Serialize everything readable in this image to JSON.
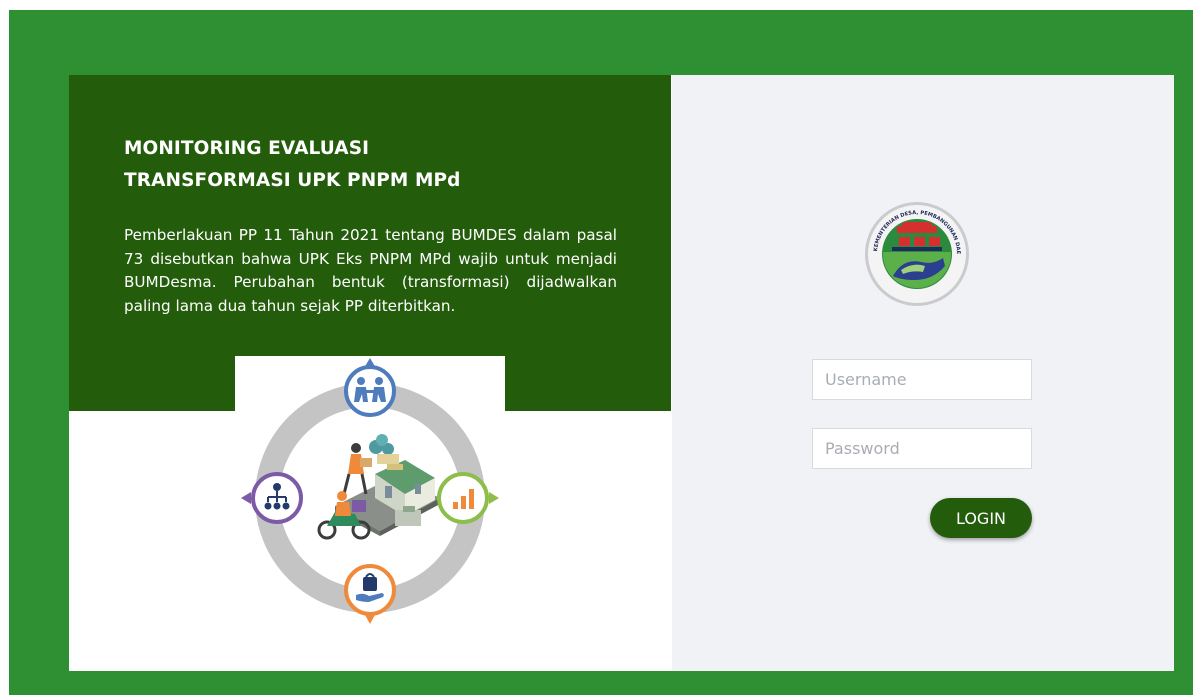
{
  "app": {
    "title_line1": "MONITORING EVALUASI",
    "title_line2": "TRANSFORMASI UPK PNPM MPd",
    "description": "Pemberlakuan PP 11 Tahun 2021 tentang BUMDES dalam pasal 73 disebutkan bahwa UPK Eks PNPM MPd wajib untuk menjadi BUMDesma. Perubahan bentuk (transformasi) dijadwalkan paling lama dua tahun sejak PP diterbitkan."
  },
  "illustration": {
    "icons": [
      "handshake-icon",
      "bar-chart-icon",
      "hand-bag-icon",
      "org-chart-icon"
    ],
    "accent_colors": {
      "top": "#4f7cbd",
      "right": "#8dbd4a",
      "bottom": "#ef8a3b",
      "left": "#7d5aa6",
      "ring": "#c4c4c4"
    }
  },
  "logo": {
    "ring_text": "KEMENTERIAN DESA, PEMBANGUNAN DAERAH TERTINGGAL, DAN TRANSMIGRASI"
  },
  "login": {
    "username_placeholder": "Username",
    "password_placeholder": "Password",
    "button_label": "LOGIN"
  },
  "colors": {
    "frame": "#2e9033",
    "header": "#235c0b",
    "panel": "#f1f2f6",
    "button": "#235c0b"
  }
}
